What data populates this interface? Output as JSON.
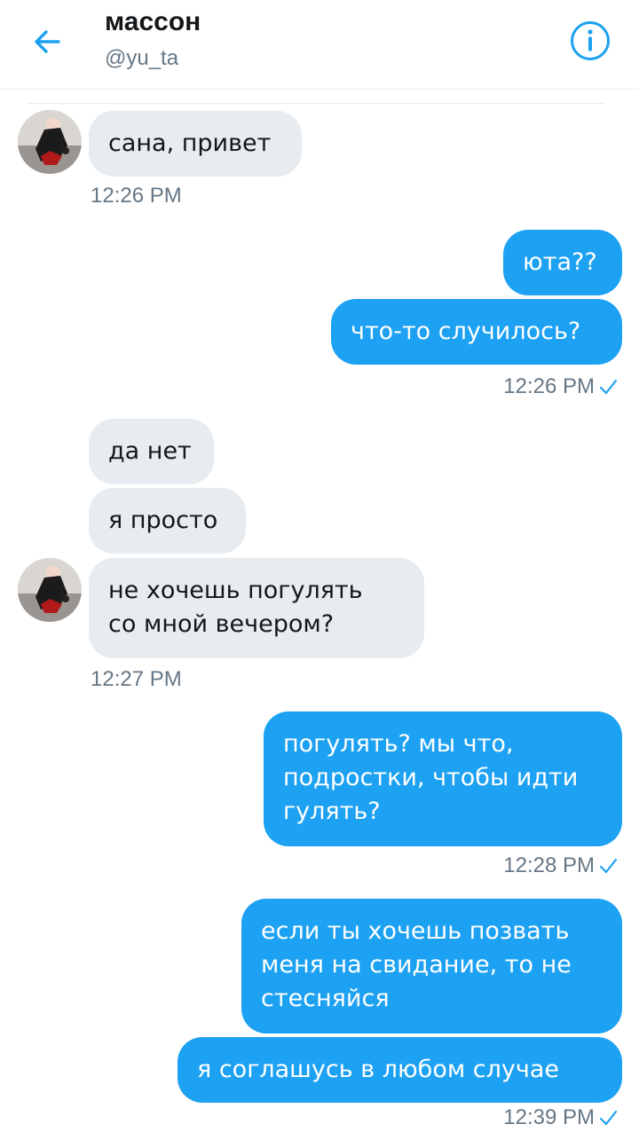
{
  "header": {
    "title": "массон",
    "handle": "@yu_ta",
    "back_icon": "arrow-left-icon",
    "info_icon": "info-icon",
    "accent_color": "#1da1f2"
  },
  "messages": [
    {
      "direction": "in",
      "text": "сана, привет"
    },
    {
      "direction": "in",
      "timestamp": "12:26 PM"
    },
    {
      "direction": "out",
      "text": "юта??"
    },
    {
      "direction": "out",
      "text": "что-то случилось?"
    },
    {
      "direction": "out",
      "timestamp": "12:26 PM",
      "read_icon": "checkmark-icon"
    },
    {
      "direction": "in",
      "text": "да нет"
    },
    {
      "direction": "in",
      "text": "я просто"
    },
    {
      "direction": "in",
      "lines": [
        "не хочешь погулять",
        "со мной вечером?"
      ]
    },
    {
      "direction": "in",
      "timestamp": "12:27 PM"
    },
    {
      "direction": "out",
      "lines": [
        "погулять? мы что,",
        "подростки, чтобы идти",
        "гулять?"
      ]
    },
    {
      "direction": "out",
      "timestamp": "12:28 PM",
      "read_icon": "checkmark-icon"
    },
    {
      "direction": "out",
      "lines": [
        "если ты хочешь позвать",
        "меня на свидание, то не",
        "стесняйся"
      ]
    },
    {
      "direction": "out",
      "text": "я соглашусь в любом случае"
    },
    {
      "direction": "out",
      "timestamp": "12:39 PM",
      "read_icon": "checkmark-icon"
    }
  ]
}
